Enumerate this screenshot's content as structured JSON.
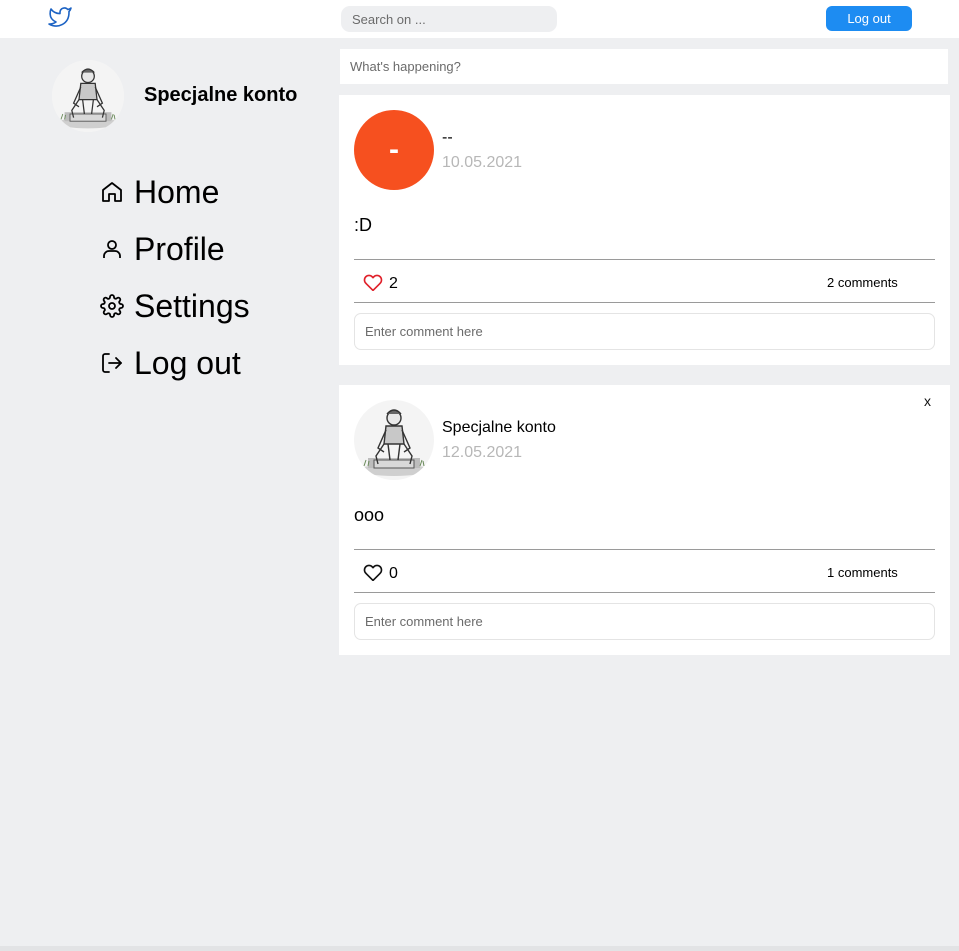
{
  "header": {
    "logo_icon": "twitter-bird-icon",
    "search_placeholder": "Search on ...",
    "logout_label": "Log out",
    "accent": "#1d8cf2"
  },
  "sidebar": {
    "profile_name": "Specjalne konto",
    "avatar_icon": "sketch-man-avatar",
    "items": [
      {
        "label": "Home",
        "icon": "home-icon"
      },
      {
        "label": "Profile",
        "icon": "user-icon"
      },
      {
        "label": "Settings",
        "icon": "gear-icon"
      },
      {
        "label": "Log out",
        "icon": "logout-icon"
      }
    ]
  },
  "compose": {
    "placeholder": "What's happening?"
  },
  "posts": [
    {
      "avatar_letter": "-",
      "avatar_color": "#f6501f",
      "author": "--",
      "date": "10.05.2021",
      "content": ":D",
      "likes": "2",
      "liked": true,
      "comments_label": "2 comments",
      "comment_placeholder": "Enter comment here",
      "deletable": false
    },
    {
      "avatar_icon": "sketch-man-avatar",
      "author": "Specjalne konto",
      "date": "12.05.2021",
      "content": "ooo",
      "likes": "0",
      "liked": false,
      "comments_label": "1 comments",
      "comment_placeholder": "Enter comment here",
      "delete_label": "x",
      "deletable": true
    }
  ]
}
